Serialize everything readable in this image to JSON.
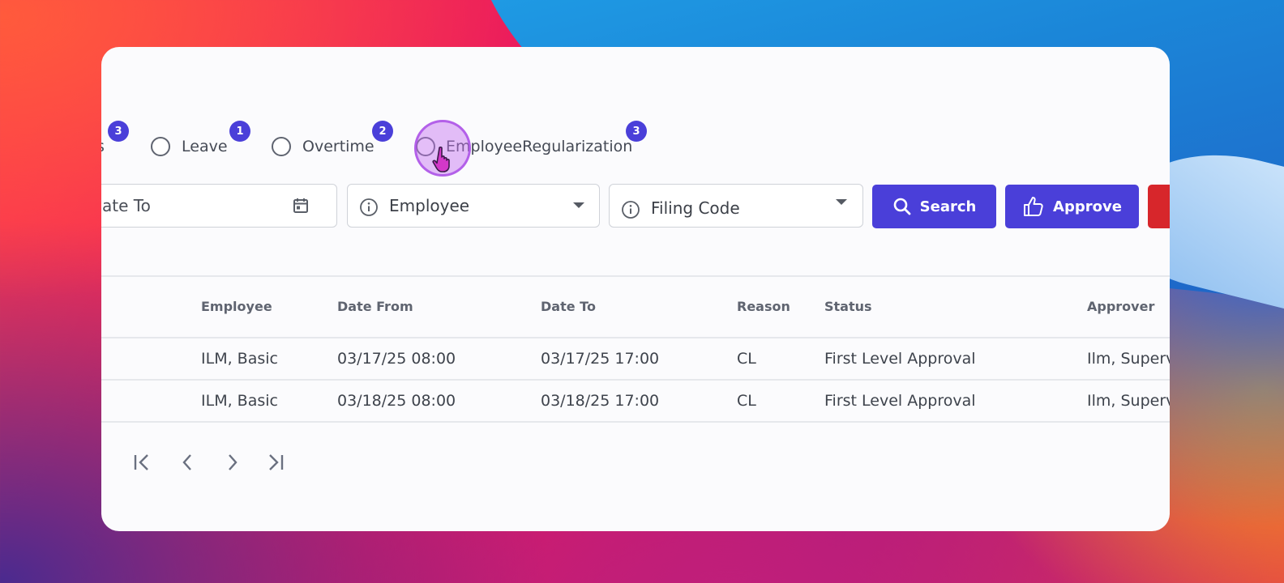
{
  "filters": {
    "items": [
      {
        "label": "s",
        "badge": "3"
      },
      {
        "label": "Leave",
        "badge": "1"
      },
      {
        "label": "Overtime",
        "badge": "2"
      },
      {
        "label": "EmployeeRegularization",
        "badge": "3"
      }
    ]
  },
  "toolbar": {
    "date_to_placeholder": "ate To",
    "employee_placeholder": "Employee",
    "filing_code_placeholder": "Filing Code",
    "search_label": "Search",
    "approve_label": "Approve"
  },
  "table": {
    "headers": [
      "Employee",
      "Date From",
      "Date To",
      "Reason",
      "Status",
      "Approver"
    ],
    "rows": [
      [
        "ILM, Basic",
        "03/17/25 08:00",
        "03/17/25 17:00",
        "CL",
        "First Level Approval",
        "Ilm, Superv"
      ],
      [
        "ILM, Basic",
        "03/18/25 08:00",
        "03/18/25 17:00",
        "CL",
        "First Level Approval",
        "Ilm, Superv"
      ]
    ]
  },
  "colors": {
    "accent": "#4a3fd9",
    "danger": "#d7262b"
  }
}
